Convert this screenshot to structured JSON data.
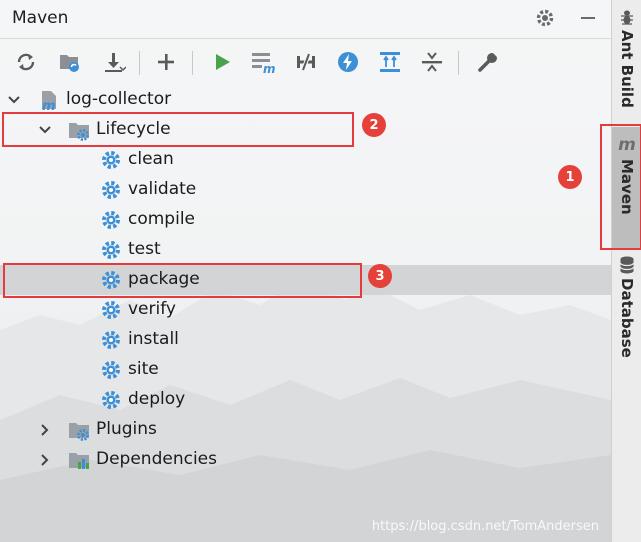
{
  "panel": {
    "title": "Maven",
    "settings_icon": "gear-icon",
    "minimize_icon": "minus-icon"
  },
  "toolbar": {
    "buttons": [
      {
        "name": "reload-icon"
      },
      {
        "name": "generate-sources-icon"
      },
      {
        "name": "download-icon"
      },
      {
        "name": "add-icon"
      },
      {
        "name": "run-icon"
      },
      {
        "name": "execute-goal-icon"
      },
      {
        "name": "toggle-offline-icon"
      },
      {
        "name": "skip-tests-icon"
      },
      {
        "name": "show-dependencies-icon"
      },
      {
        "name": "collapse-all-icon"
      },
      {
        "name": "settings-wrench-icon"
      }
    ]
  },
  "tree": {
    "project": "log-collector",
    "lifecycle": "Lifecycle",
    "goals": [
      "clean",
      "validate",
      "compile",
      "test",
      "package",
      "verify",
      "install",
      "site",
      "deploy"
    ],
    "plugins": "Plugins",
    "dependencies": "Dependencies",
    "selected_goal": "package"
  },
  "annotations": [
    "1",
    "2",
    "3"
  ],
  "side_tabs": {
    "ant": "Ant Build",
    "maven": "Maven",
    "database": "Database",
    "active": "Maven"
  },
  "watermark": "https://blog.csdn.net/TomAndersen",
  "colors": {
    "accent_blue": "#3d8fd6",
    "run_green": "#4aa34a",
    "annotation_red": "#e43c3c",
    "selection": "#d3d4d6"
  }
}
